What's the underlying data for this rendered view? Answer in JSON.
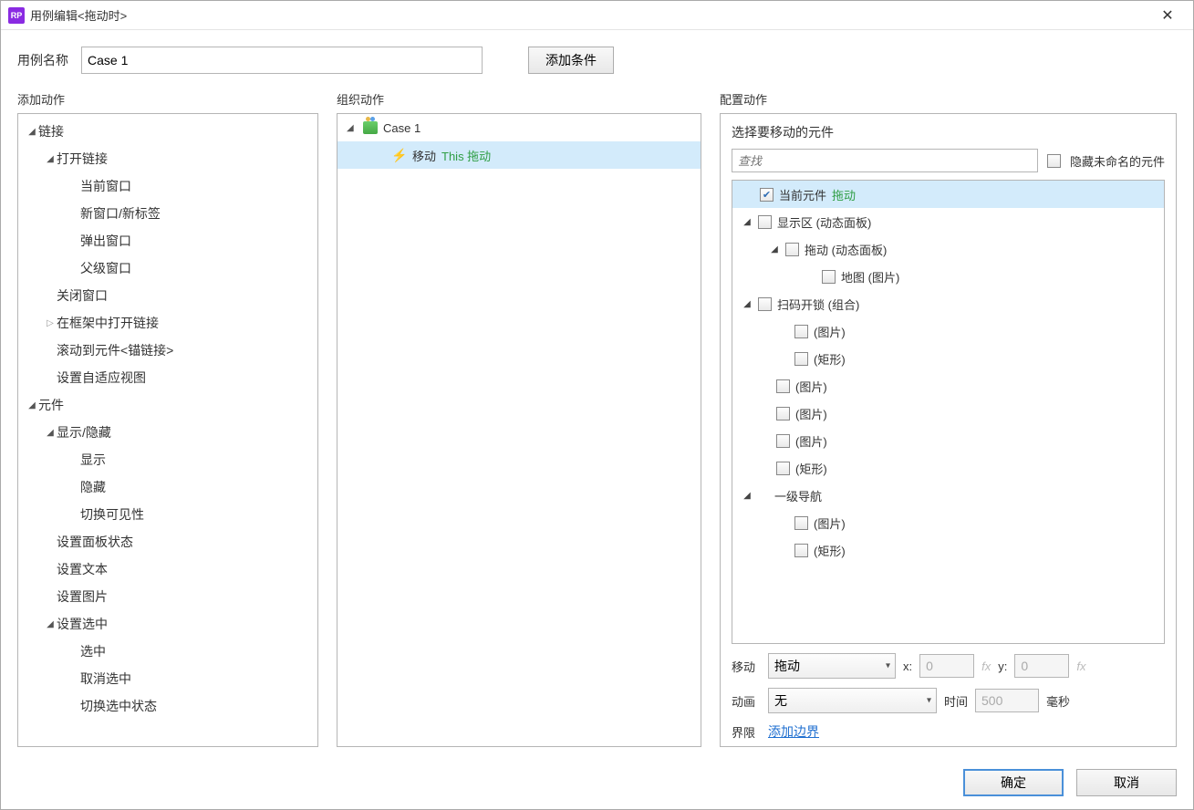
{
  "titlebar": {
    "icon_text": "RP",
    "title": "用例编辑<拖动时>"
  },
  "toprow": {
    "name_label": "用例名称",
    "name_value": "Case 1",
    "add_condition": "添加条件"
  },
  "columns": {
    "add_action": "添加动作",
    "organize_action": "组织动作",
    "configure_action": "配置动作"
  },
  "actions_tree": {
    "link": "链接",
    "open_link": "打开链接",
    "current_window": "当前窗口",
    "new_window": "新窗口/新标签",
    "popup_window": "弹出窗口",
    "parent_window": "父级窗口",
    "close_window": "关闭窗口",
    "open_in_frame": "在框架中打开链接",
    "scroll_to_widget": "滚动到元件<锚链接>",
    "set_adaptive_view": "设置自适应视图",
    "widget": "元件",
    "show_hide": "显示/隐藏",
    "show": "显示",
    "hide": "隐藏",
    "toggle_visibility": "切换可见性",
    "set_panel_state": "设置面板状态",
    "set_text": "设置文本",
    "set_image": "设置图片",
    "set_selected": "设置选中",
    "selected_on": "选中",
    "selected_off": "取消选中",
    "toggle_selected": "切换选中状态"
  },
  "organize": {
    "case_label": "Case 1",
    "move_label": "移动",
    "move_target": "This 拖动"
  },
  "configure": {
    "heading": "选择要移动的元件",
    "search_placeholder": "查找",
    "hide_unnamed": "隐藏未命名的元件",
    "widgets": {
      "current_prefix": "当前元件",
      "current_suffix": "拖动",
      "display_area": "显示区 (动态面板)",
      "drag": "拖动 (动态面板)",
      "map": "地图 (图片)",
      "scan_unlock": "扫码开锁 (组合)",
      "image": "(图片)",
      "rect": "(矩形)",
      "nav1": "一级导航"
    },
    "move_label": "移动",
    "move_type": "拖动",
    "x_label": "x:",
    "x_value": "0",
    "y_label": "y:",
    "y_value": "0",
    "fx": "fx",
    "anim_label": "动画",
    "anim_type": "无",
    "time_label": "时间",
    "time_value": "500",
    "time_unit": "毫秒",
    "bound_label": "界限",
    "add_bounds": "添加边界"
  },
  "footer": {
    "ok": "确定",
    "cancel": "取消"
  }
}
